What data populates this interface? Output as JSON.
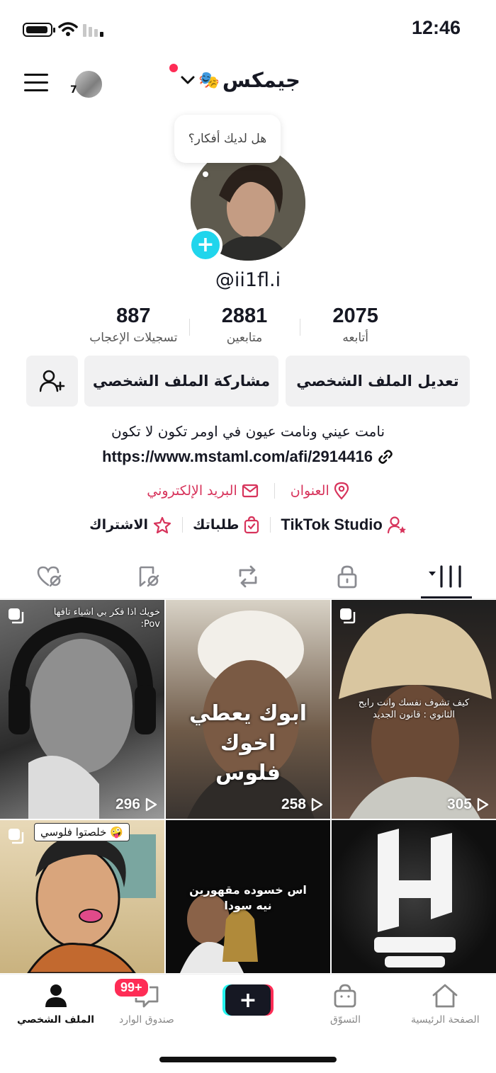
{
  "status_bar": {
    "time": "12:46"
  },
  "header": {
    "username_title": "جيمكس",
    "title_emoji": "🎭",
    "avatar_count": "7"
  },
  "bubble": {
    "text": "هل لديك أفكار؟"
  },
  "profile": {
    "handle": "@ii1fl.i"
  },
  "stats": [
    {
      "value": "887",
      "label": "تسجيلات الإعجاب"
    },
    {
      "value": "2881",
      "label": "متابعين"
    },
    {
      "value": "2075",
      "label": "أتابعه"
    }
  ],
  "buttons": {
    "edit": "تعديل الملف الشخصي",
    "share": "مشاركة الملف الشخصي"
  },
  "bio": {
    "text": "نامت عيني ونامت عيون في اومر تكون لا تكون",
    "link": "https://www.mstaml.com/afi/2914416"
  },
  "contact": {
    "address": "العنوان",
    "email": "البريد الإلكتروني"
  },
  "tools": {
    "studio": "TikTok Studio",
    "orders": "طلباتك",
    "subscription": "الاشتراك"
  },
  "videos": [
    {
      "caption": "خويك اذا فكر بي اشياء تافها\n:Pov",
      "big_text": "",
      "views": "296",
      "sticker": ""
    },
    {
      "caption": "",
      "big_text": "ابوك يعطي اخوك\nفلوس",
      "views": "258",
      "sticker": ""
    },
    {
      "caption": "كيف تشوف نفسك وانت رايح\nالثانوي : قانون الجديد",
      "big_text": "",
      "views": "305",
      "sticker": ""
    },
    {
      "caption": "",
      "big_text": "",
      "views": "",
      "sticker": "خلصتوا فلوسي 🤪"
    },
    {
      "caption": "",
      "big_text": "اس خسوده مقهورين\nنيه سودا",
      "views": "",
      "sticker": ""
    },
    {
      "caption": "",
      "big_text": "",
      "views": "",
      "sticker": ""
    }
  ],
  "bottom_nav": {
    "profile": "الملف الشخصي",
    "inbox": "صندوق الوارد",
    "inbox_badge": "99+",
    "create": "+",
    "shop": "التسوّق",
    "home": "الصفحة الرئيسية"
  },
  "colors": {
    "accent": "#fe2c55",
    "cyan": "#20d5ec",
    "link_pink": "#d7335b"
  }
}
